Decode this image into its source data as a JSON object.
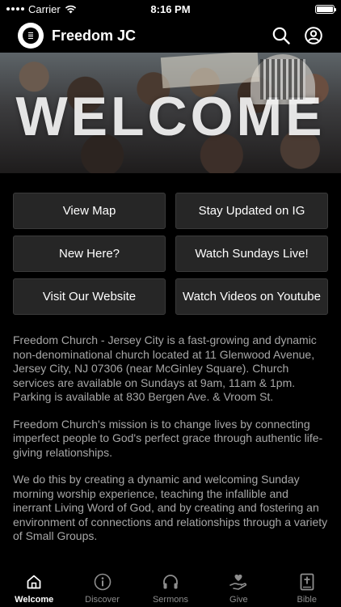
{
  "status_bar": {
    "carrier": "Carrier",
    "time": "8:16 PM"
  },
  "header": {
    "title": "Freedom JC",
    "icons": [
      "search-icon",
      "profile-icon"
    ]
  },
  "hero": {
    "overlay_text": "WELCOME"
  },
  "buttons": [
    {
      "label": "View Map"
    },
    {
      "label": "Stay Updated on IG"
    },
    {
      "label": "New Here?"
    },
    {
      "label": "Watch Sundays Live!"
    },
    {
      "label": "Visit Our Website"
    },
    {
      "label": "Watch Videos on Youtube"
    }
  ],
  "description": {
    "paragraphs": [
      "Freedom Church - Jersey City is a fast-growing and dynamic non-denominational church located at 11 Glenwood Avenue, Jersey City, NJ 07306 (near McGinley Square). Church services are available on Sundays at 9am, 11am & 1pm. Parking is available at 830 Bergen Ave. & Vroom St.",
      "Freedom Church's mission is to change lives by connecting imperfect people to God's perfect grace through authentic life-giving relationships.",
      "We do this by creating a dynamic and welcoming Sunday morning worship experience, teaching the infallible and inerrant Living Word of God, and by creating and fostering an environment of connections and relationships through a variety of Small Groups."
    ]
  },
  "tabs": [
    {
      "label": "Welcome",
      "icon": "home-icon",
      "active": true
    },
    {
      "label": "Discover",
      "icon": "info-icon",
      "active": false
    },
    {
      "label": "Sermons",
      "icon": "headphones-icon",
      "active": false
    },
    {
      "label": "Give",
      "icon": "give-icon",
      "active": false
    },
    {
      "label": "Bible",
      "icon": "bible-icon",
      "active": false
    }
  ],
  "colors": {
    "background": "#000000",
    "button_bg": "#262626",
    "text_muted": "#a7a7a7",
    "tab_inactive": "#8e8e8e"
  }
}
